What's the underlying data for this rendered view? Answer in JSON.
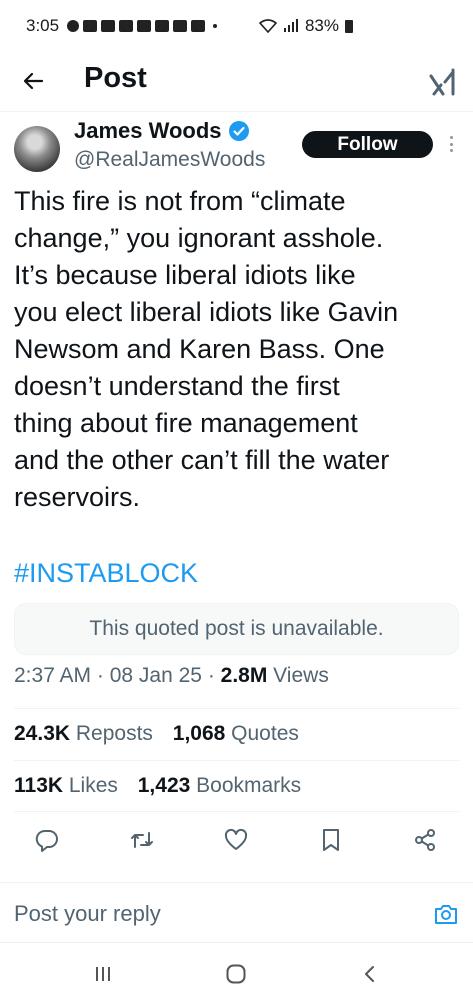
{
  "status_bar": {
    "time": "3:05",
    "battery": "83%"
  },
  "header": {
    "title": "Post"
  },
  "author": {
    "name": "James Woods",
    "handle": "@RealJamesWoods",
    "follow_label": "Follow"
  },
  "tweet": {
    "lines": [
      "This fire is not from “climate",
      "change,” you ignorant asshole.",
      "It’s because liberal idiots like",
      "you elect liberal idiots like Gavin",
      "Newsom and Karen Bass. One",
      "doesn’t understand the first",
      "thing about fire management",
      "and the other can’t fill the water",
      "reservoirs."
    ],
    "hashtag": "#INSTABLOCK"
  },
  "quoted_post": {
    "text": "This quoted post is unavailable."
  },
  "meta": {
    "time": "2:37 AM",
    "sep1": " · ",
    "date": "08 Jan 25",
    "sep2": " · ",
    "views_count": "2.8M",
    "views_label": " Views"
  },
  "stats": {
    "reposts_count": "24.3K",
    "reposts_label": " Reposts",
    "quotes_count": "1,068",
    "quotes_label": " Quotes",
    "likes_count": "113K",
    "likes_label": " Likes",
    "bookmarks_count": "1,423",
    "bookmarks_label": " Bookmarks"
  },
  "reply": {
    "placeholder": "Post your reply"
  },
  "colors": {
    "accent": "#1d9bf0",
    "text": "#0f1419",
    "muted": "#536471"
  },
  "icons": [
    "back-arrow-icon",
    "grok-icon",
    "verified-badge-icon",
    "more-icon",
    "reply-icon",
    "repost-icon",
    "like-icon",
    "bookmark-icon",
    "share-icon",
    "camera-icon",
    "recents-icon",
    "home-icon",
    "back-icon"
  ]
}
